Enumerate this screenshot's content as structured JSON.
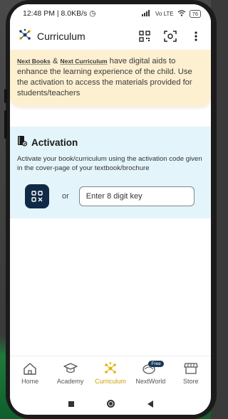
{
  "status_bar": {
    "time_speed": "12:48 PM | 8.0KB/s",
    "signal_text": "Vo LTE",
    "battery": "76"
  },
  "app_bar": {
    "title": "Curriculum",
    "icons": [
      "curriculum-logo-icon",
      "qr-code-icon",
      "scan-icon",
      "more-vert-icon"
    ]
  },
  "info": {
    "brand_books": "Next Books",
    "amp": " & ",
    "brand_curriculum": "Next Curriculum",
    "text": " have digital aids to enhance the learning experience of the child. Use the activation to access the materials provided for students/teachers"
  },
  "activation": {
    "title": "Activation",
    "description": "Activate your book/curriculum using the activation code given in the cover-page of your textbook/brochure",
    "or": "or",
    "input_placeholder": "Enter 8 digit key",
    "input_value": ""
  },
  "bottom_nav": {
    "items": [
      {
        "label": "Home",
        "icon": "home-icon"
      },
      {
        "label": "Academy",
        "icon": "graduation-cap-icon"
      },
      {
        "label": "Curriculum",
        "icon": "curriculum-icon",
        "active": true
      },
      {
        "label": "NextWorld",
        "icon": "nextworld-icon",
        "badge": "Free"
      },
      {
        "label": "Store",
        "icon": "store-icon"
      }
    ]
  },
  "colors": {
    "banner_bg": "#fdf0d0",
    "activation_bg": "#e3f5fa",
    "accent": "#c9a000",
    "scan_button": "#0f2a47"
  }
}
